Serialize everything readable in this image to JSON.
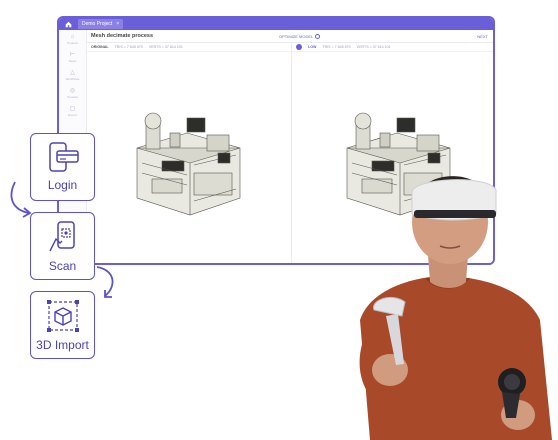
{
  "window": {
    "tab_title": "Demo Project",
    "tab_close": "×",
    "page_title": "Mesh decimate process",
    "optimize_label": "OPTIMIZE MODEL",
    "next_label": "NEXT"
  },
  "sidebar": {
    "items": [
      {
        "label": "Projects",
        "icon": "folder-icon"
      },
      {
        "label": "Steps",
        "icon": "steps-icon"
      },
      {
        "label": "Workflows",
        "icon": "workflow-icon"
      },
      {
        "label": "Preview",
        "icon": "eye-icon"
      },
      {
        "label": "Export",
        "icon": "export-icon"
      }
    ]
  },
  "panels": {
    "left": {
      "name": "ORIGINAL",
      "stats": [
        "TRIS = 7 645 570",
        "VERTS = 37 614 101"
      ]
    },
    "right": {
      "name": "LOW",
      "stats": [
        "TRIS = 7 645 570",
        "VERTS = 37 614 101"
      ]
    }
  },
  "workflow": {
    "steps": [
      {
        "label": "Login",
        "icon": "phone-card-icon"
      },
      {
        "label": "Scan",
        "icon": "phone-scan-icon"
      },
      {
        "label": "3D Import",
        "icon": "cube-import-icon"
      }
    ]
  },
  "colors": {
    "accent": "#6a5fd8",
    "card_border": "#5b53c9",
    "shirt": "#a84a2a"
  }
}
